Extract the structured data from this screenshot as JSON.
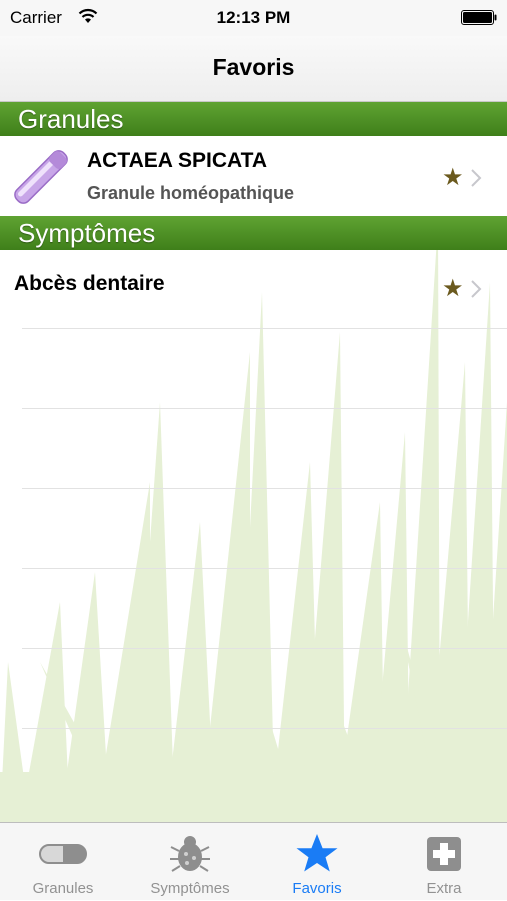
{
  "status_bar": {
    "carrier": "Carrier",
    "time": "12:13 PM"
  },
  "nav": {
    "title": "Favoris"
  },
  "sections": [
    {
      "header": "Granules",
      "rows": [
        {
          "title": "ACTAEA SPICATA",
          "subtitle": "Granule homéopathique",
          "favorite_icon": "star-icon"
        }
      ]
    },
    {
      "header": "Symptômes",
      "rows": [
        {
          "title": "Abcès dentaire",
          "favorite_icon": "star-icon"
        }
      ]
    }
  ],
  "tabs": [
    {
      "label": "Granules",
      "icon": "pill-icon",
      "active": false
    },
    {
      "label": "Symptômes",
      "icon": "bug-icon",
      "active": false
    },
    {
      "label": "Favoris",
      "icon": "star-icon",
      "active": true
    },
    {
      "label": "Extra",
      "icon": "plus-icon",
      "active": false
    }
  ],
  "colors": {
    "section_header": "#4a8b22",
    "active_tab": "#1a7cf5",
    "inactive_tab": "#929292",
    "favorite_star": "#6b5a1e",
    "grass": "#e8f2d8"
  }
}
